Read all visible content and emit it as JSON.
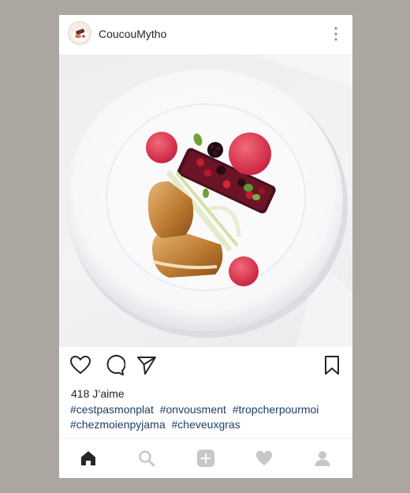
{
  "post": {
    "username": "CoucouMytho",
    "likes_text": "418 J’aime",
    "hashtags": [
      "#cestpasmonplat",
      "#onvousment",
      "#tropcherpourmoi",
      "#chezmoienpyjama",
      "#cheveuxgras"
    ]
  },
  "icons": {
    "more": "more-vertical-icon",
    "like": "heart-outline-icon",
    "comment": "comment-icon",
    "share": "send-icon",
    "save": "bookmark-icon",
    "nav": [
      "home-icon",
      "search-icon",
      "add-icon",
      "heart-icon",
      "profile-icon"
    ]
  },
  "colors": {
    "hashtag": "#1e3f66",
    "text": "#262626",
    "inactive_nav": "#c7c7c7",
    "background": "#aaa7a1"
  }
}
